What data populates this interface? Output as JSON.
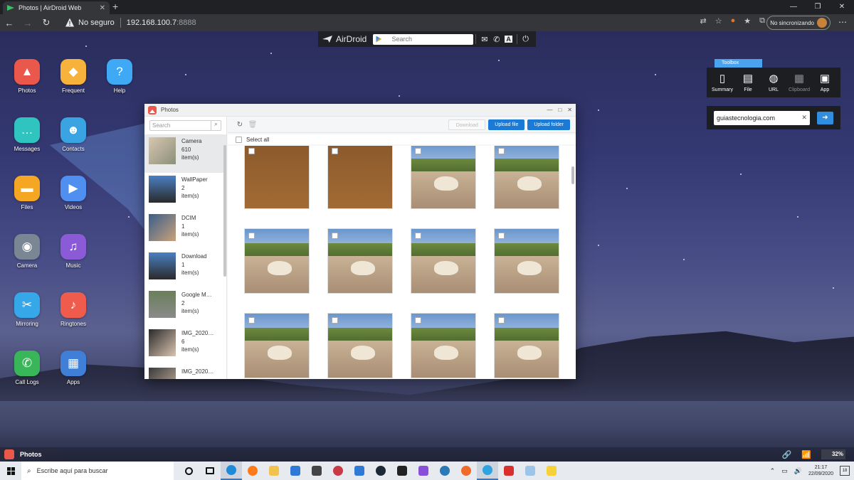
{
  "browser": {
    "tab_title": "Photos | AirDroid Web",
    "security_label": "No seguro",
    "url_host": "192.168.100.7",
    "url_port": ":8888",
    "profile_label": "No sincronizando"
  },
  "airdroid_bar": {
    "logo_text": "AirDroid",
    "search_placeholder": "Search"
  },
  "desktop_icons": [
    {
      "label": "Photos",
      "icon": "photos-icon",
      "color": "#e9584a"
    },
    {
      "label": "Frequent",
      "icon": "frequent-icon",
      "color": "#f6b23b"
    },
    {
      "label": "Help",
      "icon": "help-icon",
      "color": "#3fa9f5"
    },
    {
      "label": "Messages",
      "icon": "messages-icon",
      "color": "#2fc4c0"
    },
    {
      "label": "Contacts",
      "icon": "contacts-icon",
      "color": "#3aa3e2"
    },
    {
      "label": "Files",
      "icon": "files-icon",
      "color": "#f5a623"
    },
    {
      "label": "Videos",
      "icon": "videos-icon",
      "color": "#4f8ff0"
    },
    {
      "label": "Camera",
      "icon": "camera-icon",
      "color": "#7a8694"
    },
    {
      "label": "Music",
      "icon": "music-icon",
      "color": "#8b5ad6"
    },
    {
      "label": "Mirroring",
      "icon": "mirroring-icon",
      "color": "#36a7e8"
    },
    {
      "label": "Ringtones",
      "icon": "ringtones-icon",
      "color": "#ef5b4c"
    },
    {
      "label": "Call Logs",
      "icon": "call-logs-icon",
      "color": "#39b55a"
    },
    {
      "label": "Apps",
      "icon": "apps-icon",
      "color": "#3f7fd8"
    }
  ],
  "toolbox": {
    "tab_label": "Toolbox",
    "items": [
      {
        "label": "Summary",
        "icon": "phone-icon"
      },
      {
        "label": "File",
        "icon": "file-icon"
      },
      {
        "label": "URL",
        "icon": "globe-icon"
      },
      {
        "label": "Clipboard",
        "icon": "clipboard-icon"
      },
      {
        "label": "App",
        "icon": "app-icon"
      }
    ],
    "url_value": "guiastecnologia.com"
  },
  "photos_window": {
    "title": "Photos",
    "search_placeholder": "Search",
    "albums": [
      {
        "name": "Camera",
        "count": "610",
        "unit": "item(s)"
      },
      {
        "name": "WallPaper",
        "count": "2",
        "unit": "item(s)"
      },
      {
        "name": "DCIM",
        "count": "1",
        "unit": "item(s)"
      },
      {
        "name": "Download",
        "count": "1",
        "unit": "item(s)"
      },
      {
        "name": "Google M…",
        "count": "2",
        "unit": "item(s)"
      },
      {
        "name": "IMG_2020…",
        "count": "6",
        "unit": "item(s)"
      },
      {
        "name": "IMG_2020…",
        "count": "",
        "unit": ""
      }
    ],
    "download_label": "Download",
    "upload_file_label": "Upload file",
    "upload_folder_label": "Upload folder",
    "select_all_label": "Select all"
  },
  "dock": {
    "active_app": "Photos",
    "battery": "32%"
  },
  "taskbar": {
    "search_text": "Escribe aquí para buscar",
    "time": "21:17",
    "date": "22/09/2020",
    "notifications": "18"
  }
}
